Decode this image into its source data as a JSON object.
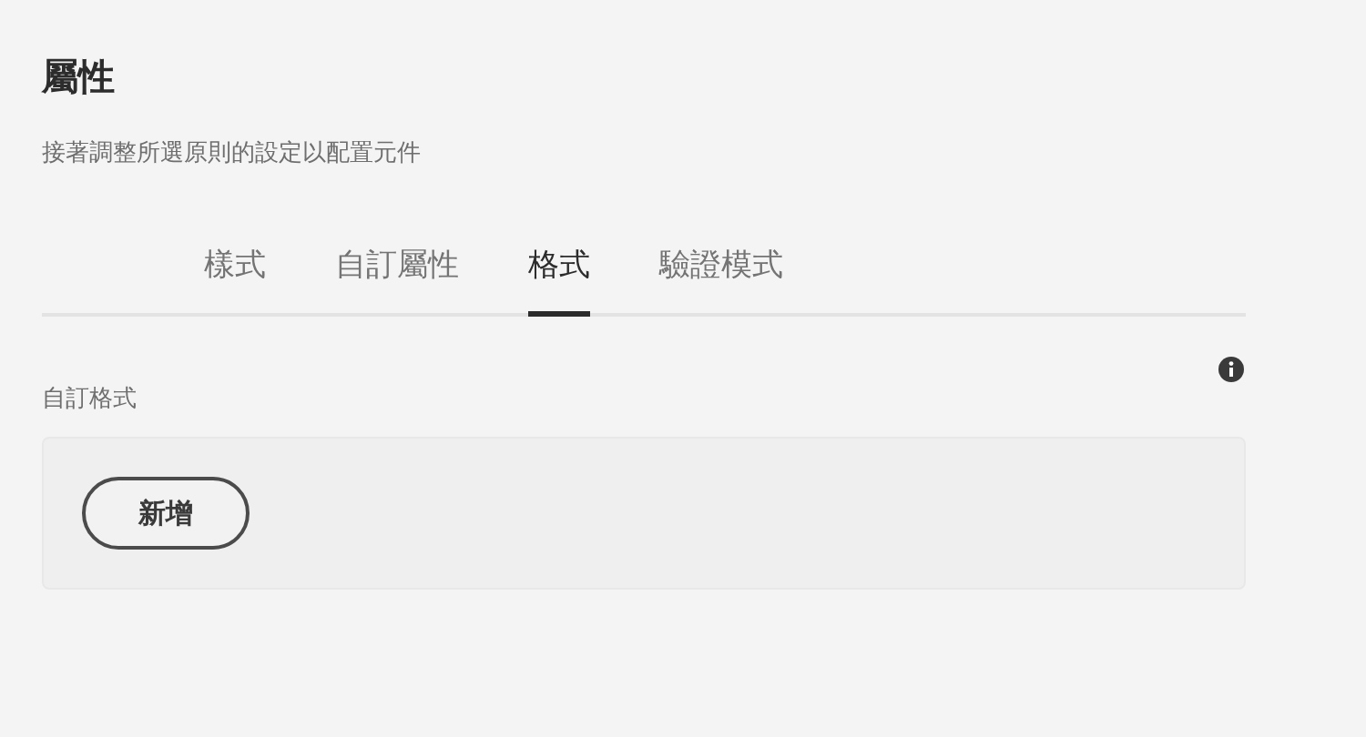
{
  "title": "屬性",
  "subtitle": "接著調整所選原則的設定以配置元件",
  "tabs": [
    {
      "label": "樣式",
      "selected": false
    },
    {
      "label": "自訂屬性",
      "selected": false
    },
    {
      "label": "格式",
      "selected": true
    },
    {
      "label": "驗證模式",
      "selected": false
    }
  ],
  "field": {
    "label": "自訂格式",
    "button": "新增"
  }
}
